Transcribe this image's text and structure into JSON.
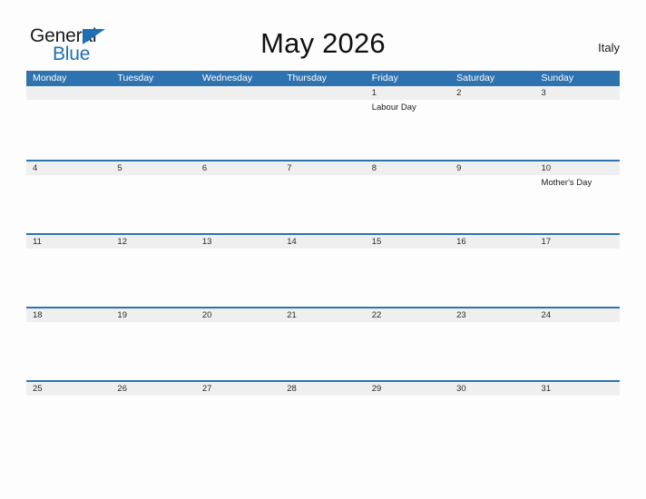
{
  "header": {
    "logo": {
      "word_one": "General",
      "word_two": "Blue",
      "triangle_icon": "triangle-icon",
      "brand_color": "#1f6fb5"
    },
    "title": "May 2026",
    "country": "Italy"
  },
  "calendar": {
    "accent_color": "#2f72b0",
    "date_band_color": "#efefef",
    "day_headers": [
      "Monday",
      "Tuesday",
      "Wednesday",
      "Thursday",
      "Friday",
      "Saturday",
      "Sunday"
    ],
    "weeks": [
      {
        "days": [
          {
            "date": "",
            "events": []
          },
          {
            "date": "",
            "events": []
          },
          {
            "date": "",
            "events": []
          },
          {
            "date": "",
            "events": []
          },
          {
            "date": "1",
            "events": [
              "Labour Day"
            ]
          },
          {
            "date": "2",
            "events": []
          },
          {
            "date": "3",
            "events": []
          }
        ]
      },
      {
        "days": [
          {
            "date": "4",
            "events": []
          },
          {
            "date": "5",
            "events": []
          },
          {
            "date": "6",
            "events": []
          },
          {
            "date": "7",
            "events": []
          },
          {
            "date": "8",
            "events": []
          },
          {
            "date": "9",
            "events": []
          },
          {
            "date": "10",
            "events": [
              "Mother's Day"
            ]
          }
        ]
      },
      {
        "days": [
          {
            "date": "11",
            "events": []
          },
          {
            "date": "12",
            "events": []
          },
          {
            "date": "13",
            "events": []
          },
          {
            "date": "14",
            "events": []
          },
          {
            "date": "15",
            "events": []
          },
          {
            "date": "16",
            "events": []
          },
          {
            "date": "17",
            "events": []
          }
        ]
      },
      {
        "days": [
          {
            "date": "18",
            "events": []
          },
          {
            "date": "19",
            "events": []
          },
          {
            "date": "20",
            "events": []
          },
          {
            "date": "21",
            "events": []
          },
          {
            "date": "22",
            "events": []
          },
          {
            "date": "23",
            "events": []
          },
          {
            "date": "24",
            "events": []
          }
        ]
      },
      {
        "days": [
          {
            "date": "25",
            "events": []
          },
          {
            "date": "26",
            "events": []
          },
          {
            "date": "27",
            "events": []
          },
          {
            "date": "28",
            "events": []
          },
          {
            "date": "29",
            "events": []
          },
          {
            "date": "30",
            "events": []
          },
          {
            "date": "31",
            "events": []
          }
        ]
      }
    ]
  }
}
